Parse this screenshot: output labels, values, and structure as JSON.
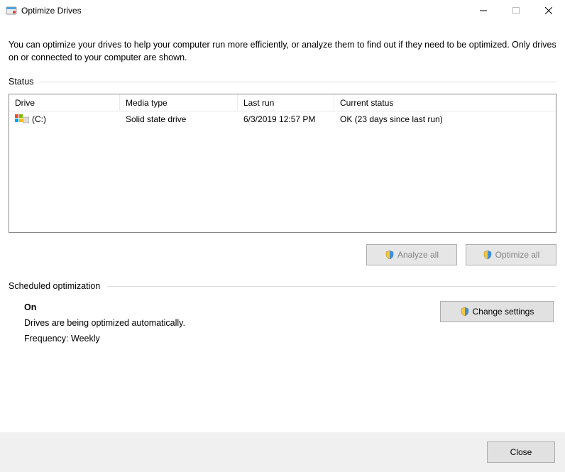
{
  "window": {
    "title": "Optimize Drives"
  },
  "intro": "You can optimize your drives to help your computer run more efficiently, or analyze them to find out if they need to be optimized. Only drives on or connected to your computer are shown.",
  "status_section_label": "Status",
  "columns": {
    "drive": "Drive",
    "media": "Media type",
    "last": "Last run",
    "status": "Current status"
  },
  "rows": [
    {
      "drive": "(C:)",
      "media": "Solid state drive",
      "last": "6/3/2019 12:57 PM",
      "status": "OK (23 days since last run)"
    }
  ],
  "buttons": {
    "analyze": "Analyze all",
    "optimize": "Optimize all",
    "change": "Change settings",
    "close": "Close"
  },
  "sched_section_label": "Scheduled optimization",
  "sched": {
    "state": "On",
    "desc": "Drives are being optimized automatically.",
    "freq": "Frequency: Weekly"
  }
}
